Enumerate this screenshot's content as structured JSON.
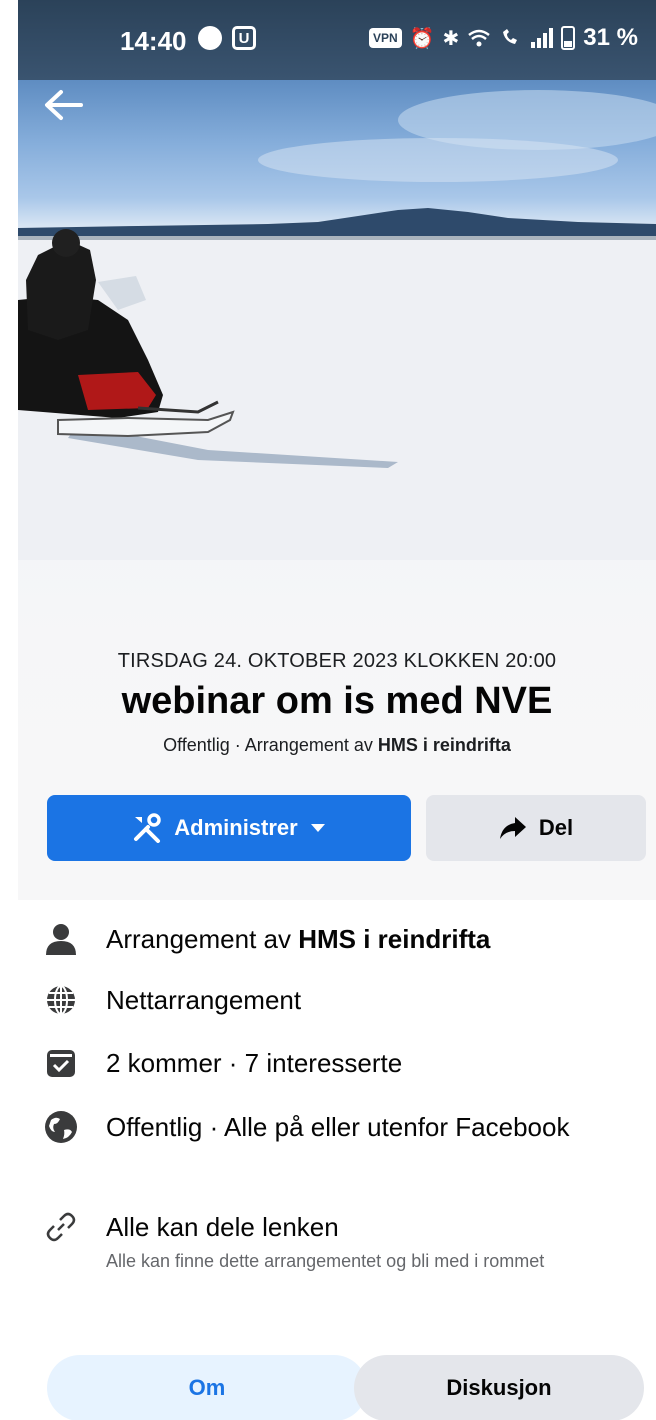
{
  "status_bar": {
    "time": "14:40",
    "vpn": "VPN",
    "battery": "31 %"
  },
  "event": {
    "date": "TIRSDAG 24. OKTOBER 2023 KLOKKEN 20:00",
    "title": "webinar om is med NVE",
    "subtitle_prefix": "Offentlig · Arrangement av ",
    "organizer": "HMS i reindrifta"
  },
  "actions": {
    "manage_label": "Administrer",
    "share_label": "Del"
  },
  "details": {
    "organizer_prefix": "Arrangement av ",
    "organizer_name": "HMS i reindrifta",
    "location": "Nettarrangement",
    "attendance": "2 kommer · 7 interesserte",
    "privacy": "Offentlig · Alle på eller utenfor Facebook",
    "share_link": "Alle kan dele lenken",
    "share_link_sub": "Alle kan finne dette arrangementet og bli med i rommet"
  },
  "tabs": {
    "about": "Om",
    "discussion": "Diskusjon"
  },
  "colors": {
    "accent": "#1b74e4",
    "secondary_button": "#e4e6eb",
    "active_tab_bg": "#e7f3ff"
  },
  "icons": [
    "back-arrow-icon",
    "messenger-icon",
    "u-app-icon",
    "alarm-icon",
    "bluetooth-icon",
    "wifi-icon",
    "signal-icon",
    "battery-icon",
    "tools-icon",
    "caret-down-icon",
    "share-arrow-icon",
    "person-icon",
    "globe-icon",
    "calendar-check-icon",
    "earth-icon",
    "link-icon"
  ]
}
